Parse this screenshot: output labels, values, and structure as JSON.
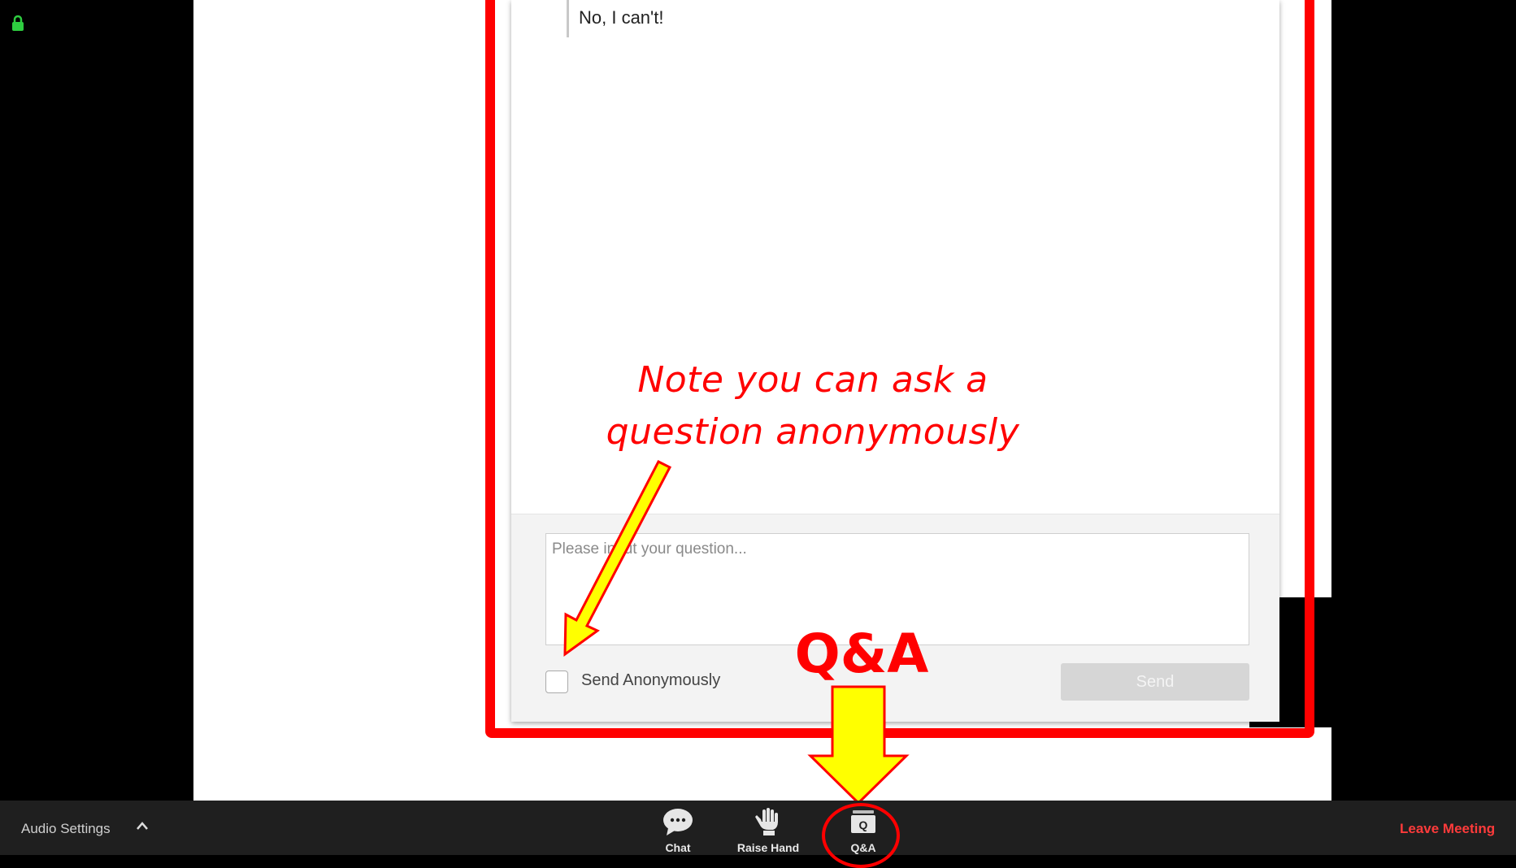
{
  "colors": {
    "annotation_red": "#ff0000",
    "arrow_yellow": "#ffff00",
    "toolbar_bg": "#1f1f1f",
    "leave_red": "#ff3b3b"
  },
  "qa_panel": {
    "answer_text": "No, I can't!",
    "question_placeholder": "Please input your question...",
    "send_anonymously_label": "Send Anonymously",
    "send_anonymously_checked": false,
    "send_label": "Send"
  },
  "annotations": {
    "note_line1": "Note you can ask a",
    "note_line2": "question anonymously",
    "qa_label": "Q&A"
  },
  "toolbar": {
    "audio_settings_label": "Audio Settings",
    "chat_label": "Chat",
    "raise_hand_label": "Raise Hand",
    "qa_label": "Q&A",
    "leave_label": "Leave Meeting"
  },
  "icons": {
    "lock": "lock-icon",
    "audio_caret": "chevron-up-icon",
    "chat": "chat-bubble-icon",
    "raise_hand": "hand-icon",
    "qa": "qa-icon"
  }
}
